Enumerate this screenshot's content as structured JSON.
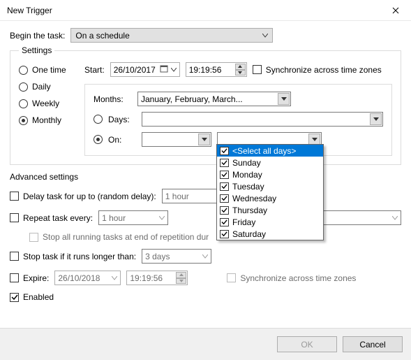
{
  "window": {
    "title": "New Trigger"
  },
  "begin": {
    "label": "Begin the task:",
    "value": "On a schedule"
  },
  "settings": {
    "legend": "Settings",
    "schedule_options": {
      "one_time": "One time",
      "daily": "Daily",
      "weekly": "Weekly",
      "monthly": "Monthly"
    },
    "start_label": "Start:",
    "start_date": "26/10/2017",
    "start_time": "19:19:56",
    "sync_tz": "Synchronize across time zones",
    "months_label": "Months:",
    "months_value": "January, February, March...",
    "days_label": "Days:",
    "days_value": "",
    "on_label": "On:",
    "on_week_value": "",
    "on_day_value": ""
  },
  "days_dropdown": {
    "select_all": "<Select all days>",
    "sunday": "Sunday",
    "monday": "Monday",
    "tuesday": "Tuesday",
    "wednesday": "Wednesday",
    "thursday": "Thursday",
    "friday": "Friday",
    "saturday": "Saturday"
  },
  "advanced": {
    "legend": "Advanced settings",
    "delay_label": "Delay task for up to (random delay):",
    "delay_value": "1 hour",
    "repeat_label": "Repeat task every:",
    "repeat_value": "1 hour",
    "repeat_duration_value": "",
    "stop_running_label": "Stop all running tasks at end of repetition dur",
    "stop_if_longer_label": "Stop task if it runs longer than:",
    "stop_if_longer_value": "3 days",
    "expire_label": "Expire:",
    "expire_date": "26/10/2018",
    "expire_time": "19:19:56",
    "expire_sync_tz": "Synchronize across time zones",
    "enabled_label": "Enabled"
  },
  "buttons": {
    "ok": "OK",
    "cancel": "Cancel"
  }
}
